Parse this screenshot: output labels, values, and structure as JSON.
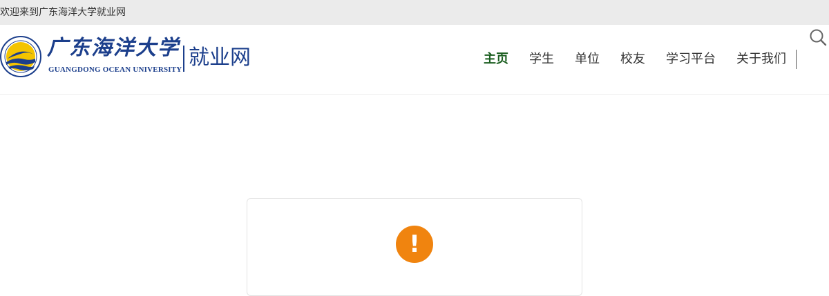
{
  "topbar": {
    "welcome_text": "欢迎来到广东海洋大学就业网"
  },
  "logo": {
    "name_cn": "广东海洋大学",
    "name_en": "GUANGDONG OCEAN UNIVERSITY",
    "subtitle": "就业网"
  },
  "nav": {
    "items": [
      {
        "label": "主页",
        "active": true
      },
      {
        "label": "学生",
        "active": false
      },
      {
        "label": "单位",
        "active": false
      },
      {
        "label": "校友",
        "active": false
      },
      {
        "label": "学习平台",
        "active": false
      },
      {
        "label": "关于我们",
        "active": false
      }
    ],
    "active_color": "#1b5e20"
  },
  "icons": {
    "search": "search-icon",
    "alert": "exclamation-icon"
  },
  "alert": {
    "symbol": "!",
    "color": "#f0840f"
  },
  "colors": {
    "brand_blue": "#1c3f8c",
    "topbar_bg": "#ebebeb"
  }
}
